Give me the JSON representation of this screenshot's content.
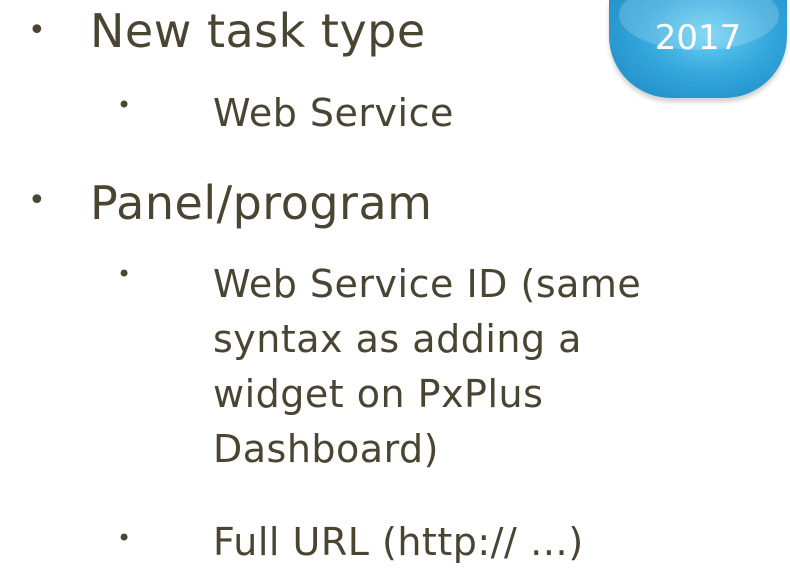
{
  "badge": {
    "year": "2017"
  },
  "bullets": [
    {
      "text": "New task type",
      "children": [
        "Web Service"
      ]
    },
    {
      "text": "Panel/program",
      "children": [
        {
          "lines": [
            "Web Service ID (same",
            "syntax as adding a",
            "widget on PxPlus",
            "Dashboard)"
          ]
        },
        {
          "lines": [
            "Full URL (http:// …)"
          ]
        }
      ]
    }
  ],
  "colors": {
    "text": "#4a4533",
    "badge": "#2c9fd8"
  },
  "icons": {
    "bullet": "bullet-dot-icon"
  }
}
